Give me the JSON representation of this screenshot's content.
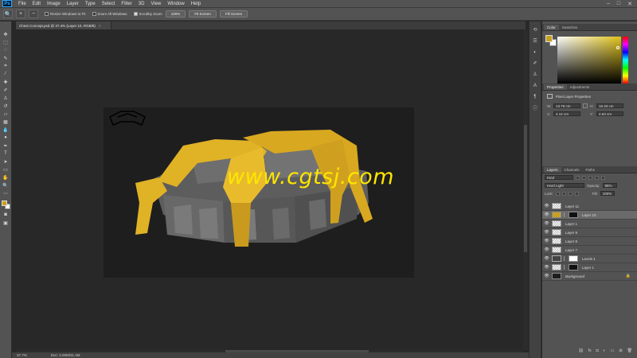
{
  "app": {
    "logo": "Ps",
    "menu": [
      "File",
      "Edit",
      "Image",
      "Layer",
      "Type",
      "Select",
      "Filter",
      "3D",
      "View",
      "Window",
      "Help"
    ],
    "window_controls": [
      "–",
      "□",
      "✕"
    ]
  },
  "options_bar": {
    "resize_windows": "Resize Windows to Fit",
    "zoom_all": "Zoom All Windows",
    "scrubby_zoom": "Scrubby Zoom",
    "btn_100": "100%",
    "btn_fit": "Fit Screen",
    "btn_fill": "Fill Screen"
  },
  "document": {
    "tab_title": "Chest Concept.psd @ 37.4% (Layer 10, RGB/8)",
    "close": "×",
    "zoom": "37.7%",
    "doc_info": "Doc: 3.00M/31.4M",
    "watermark": "www.cgtsj.com"
  },
  "colors": {
    "foreground": "#c8a122",
    "background": "#ffffff",
    "accent_gold": "#e0b226"
  },
  "panels": {
    "color_tabs": [
      "Color",
      "Swatches"
    ],
    "props_tabs": [
      "Properties",
      "Adjustments"
    ],
    "props_title": "Pixel Layer Properties",
    "props": {
      "w_label": "W:",
      "w_value": "13.76 cm",
      "h_label": "H:",
      "h_value": "16.33 cm",
      "x_label": "X:",
      "x_value": "4.12 cm",
      "y_label": "Y:",
      "y_value": "4.63 cm",
      "go": "GO"
    },
    "layers_tabs": [
      "Layers",
      "Channels",
      "Paths"
    ],
    "kind": "Kind",
    "blend_mode": "Hard Light",
    "opacity_label": "Opacity:",
    "opacity_value": "85%",
    "lock_label": "Lock:",
    "fill_label": "Fill:",
    "fill_value": "100%",
    "layers": [
      {
        "name": "Layer 11"
      },
      {
        "name": "Layer 10"
      },
      {
        "name": "Layer 1"
      },
      {
        "name": "Layer 9"
      },
      {
        "name": "Layer 8"
      },
      {
        "name": "Layer 7"
      },
      {
        "name": "Levels 1"
      },
      {
        "name": "Layer 1"
      },
      {
        "name": "Background"
      }
    ]
  }
}
